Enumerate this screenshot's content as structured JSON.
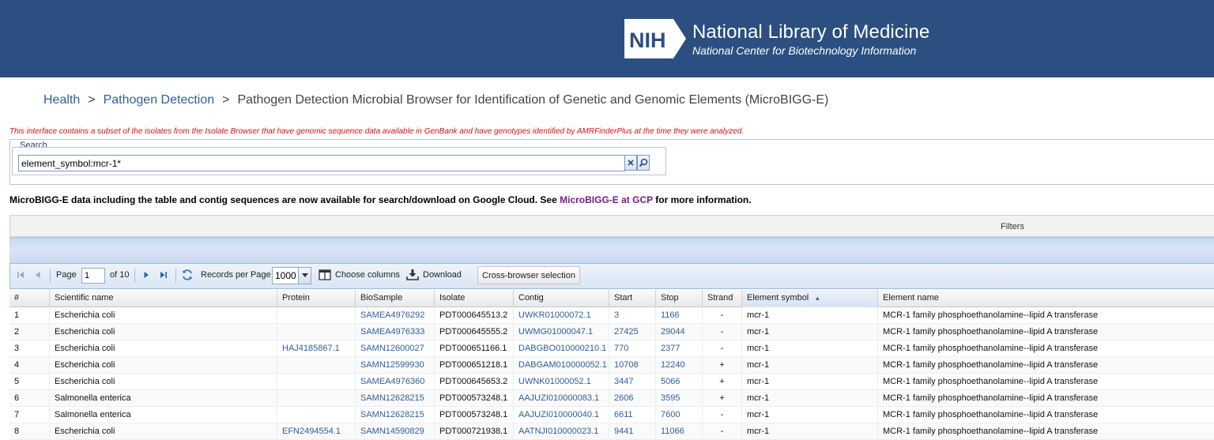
{
  "header": {
    "badge_text": "NIH",
    "title": "National Library of Medicine",
    "subtitle": "National Center for Biotechnology Information",
    "background": "#2b4f81"
  },
  "breadcrumb": {
    "items": [
      "Health",
      "Pathogen Detection"
    ],
    "separator": ">",
    "current": "Pathogen Detection Microbial Browser for Identification of Genetic and Genomic Elements (MicroBIGG-E)"
  },
  "notice": "This interface contains a subset of the isolates from the Isolate Browser that have genomic sequence data available in GenBank and have genotypes identified by AMRFinderPlus at the time they were analyzed.",
  "search": {
    "legend": "Search",
    "value": "element_symbol:mcr-1*",
    "clear_icon": "close-icon",
    "go_icon": "search-icon"
  },
  "gcp": {
    "before": "MicroBIGG-E data including the table and contig sequences are now available for search/download on Google Cloud. See ",
    "link": "MicroBIGG-E at GCP",
    "after": " for more information.",
    "link_color": "#7b1a86"
  },
  "filters": {
    "label": "Filters"
  },
  "toolbar": {
    "page_label": "Page",
    "page_value": "1",
    "of_label": "of 10",
    "records_label": "Records per Page",
    "records_value": "1000",
    "choose_columns": "Choose columns",
    "download": "Download",
    "cross_browser": "Cross-browser selection"
  },
  "grid": {
    "columns": [
      "#",
      "Scientific name",
      "Protein",
      "BioSample",
      "Isolate",
      "Contig",
      "Start",
      "Stop",
      "Strand",
      "Element symbol",
      "Element name"
    ],
    "sort_indicator": "▲",
    "rows": [
      [
        "1",
        "Escherichia coli",
        "",
        "SAMEA4976292",
        "PDT000645513.2",
        "UWKR01000072.1",
        "3",
        "1166",
        "-",
        "mcr-1",
        "MCR-1 family phosphoethanolamine--lipid A transferase"
      ],
      [
        "2",
        "Escherichia coli",
        "",
        "SAMEA4976333",
        "PDT000645555.2",
        "UWMG01000047.1",
        "27425",
        "29044",
        "-",
        "mcr-1",
        "MCR-1 family phosphoethanolamine--lipid A transferase"
      ],
      [
        "3",
        "Escherichia coli",
        "HAJ4185867.1",
        "SAMN12600027",
        "PDT000651166.1",
        "DABGBO010000210.1",
        "770",
        "2377",
        "-",
        "mcr-1",
        "MCR-1 family phosphoethanolamine--lipid A transferase"
      ],
      [
        "4",
        "Escherichia coli",
        "",
        "SAMN12599930",
        "PDT000651218.1",
        "DABGAM010000052.1",
        "10708",
        "12240",
        "+",
        "mcr-1",
        "MCR-1 family phosphoethanolamine--lipid A transferase"
      ],
      [
        "5",
        "Escherichia coli",
        "",
        "SAMEA4976360",
        "PDT000645653.2",
        "UWNK01000052.1",
        "3447",
        "5066",
        "+",
        "mcr-1",
        "MCR-1 family phosphoethanolamine--lipid A transferase"
      ],
      [
        "6",
        "Salmonella enterica",
        "",
        "SAMN12628215",
        "PDT000573248.1",
        "AAJUZI010000083.1",
        "2606",
        "3595",
        "+",
        "mcr-1",
        "MCR-1 family phosphoethanolamine--lipid A transferase"
      ],
      [
        "7",
        "Salmonella enterica",
        "",
        "SAMN12628215",
        "PDT000573248.1",
        "AAJUZI010000040.1",
        "6611",
        "7600",
        "-",
        "mcr-1",
        "MCR-1 family phosphoethanolamine--lipid A transferase"
      ],
      [
        "8",
        "Escherichia coli",
        "EFN2494554.1",
        "SAMN14590829",
        "PDT000721938.1",
        "AATNJI010000023.1",
        "9441",
        "11066",
        "-",
        "mcr-1",
        "MCR-1 family phosphoethanolamine--lipid A transferase"
      ]
    ]
  }
}
